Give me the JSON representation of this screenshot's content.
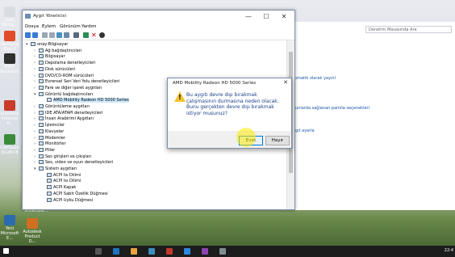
{
  "desktop": {
    "icons": [
      {
        "label": "Geri Dönüş...",
        "color": "#d9dde2"
      },
      {
        "label": "Samsung Kies 3",
        "color": "#e04c2a"
      },
      {
        "label": "ESET Sonkoruk...",
        "color": "#2f2f2f"
      },
      {
        "label": "Autodesk Inventor P...",
        "color": "#c83a2a"
      },
      {
        "label": "Camtasia Studio 8",
        "color": "#3a8a3a"
      },
      {
        "label": "Yeni Microsoft E...",
        "color": "#2b6cb0"
      },
      {
        "label": "Autodesk Product D...",
        "color": "#d07020"
      }
    ],
    "showcase_label": "Showcase..."
  },
  "device_manager": {
    "title": "Aygıt Yöneticisi",
    "window_controls": {
      "minimize": "—",
      "maximize": "☐",
      "close": "✕"
    },
    "menu": [
      "Dosya",
      "Eylem",
      "Görünüm",
      "Yardım"
    ],
    "tree": [
      {
        "label": "onay-Bilgisayar",
        "expander": "▾",
        "level": 0
      },
      {
        "label": "Ağ bağdaştırıcıları",
        "expander": "›",
        "level": 1
      },
      {
        "label": "Bilgisayar",
        "expander": "›",
        "level": 1
      },
      {
        "label": "Depolama denetleyicileri",
        "expander": "›",
        "level": 1
      },
      {
        "label": "Disk sürücüleri",
        "expander": "›",
        "level": 1
      },
      {
        "label": "DVD/CD-ROM sürücüleri",
        "expander": "›",
        "level": 1
      },
      {
        "label": "Evrensel Seri Veri Yolu denetleyicileri",
        "expander": "›",
        "level": 1
      },
      {
        "label": "Fare ve diğer işaret aygıtları",
        "expander": "›",
        "level": 1
      },
      {
        "label": "Görüntü bağdaştırıcıları",
        "expander": "▾",
        "level": 1
      },
      {
        "label": "AMD Mobility Radeon HD 5000 Series",
        "expander": "",
        "level": 2,
        "selected": true
      },
      {
        "label": "Görüntüleme aygıtları",
        "expander": "›",
        "level": 1
      },
      {
        "label": "IDE ATA/ATAPI denetleyicileri",
        "expander": "›",
        "level": 1
      },
      {
        "label": "İnsan Arabirimi Aygıtları",
        "expander": "›",
        "level": 1
      },
      {
        "label": "İşlemciler",
        "expander": "›",
        "level": 1
      },
      {
        "label": "Klavyeler",
        "expander": "›",
        "level": 1
      },
      {
        "label": "Modemler",
        "expander": "›",
        "level": 1
      },
      {
        "label": "Monitörler",
        "expander": "›",
        "level": 1
      },
      {
        "label": "Piller",
        "expander": "›",
        "level": 1
      },
      {
        "label": "Ses girişleri ve çıkışları",
        "expander": "›",
        "level": 1
      },
      {
        "label": "Ses, video ve oyun denetleyicileri",
        "expander": "›",
        "level": 1
      },
      {
        "label": "Sistem aygıtları",
        "expander": "▾",
        "level": 1
      },
      {
        "label": "ACPI Isı Dilimi",
        "expander": "",
        "level": 2
      },
      {
        "label": "ACPI Isı Dilimi",
        "expander": "",
        "level": 2
      },
      {
        "label": "ACPI Kapak",
        "expander": "",
        "level": 2
      },
      {
        "label": "ACPI Sabit Özellik Düğmesi",
        "expander": "",
        "level": 2
      },
      {
        "label": "ACPI Uyku Düğmesi",
        "expander": "",
        "level": 2
      }
    ]
  },
  "control_panel": {
    "search_placeholder": "Denetim Masasında Ara",
    "links": [
      "otomatik olarak yayınl",
      "oyunlarda sağlanan pamila seçenekleri",
      "aygıt ayarla"
    ]
  },
  "dialog": {
    "title": "AMD Mobility Radeon HD 5000 Series",
    "close": "✕",
    "message": "Bu aygıtı devre dışı bırakmak çalışmasının durmasına neden olacak. Bunu gerçekten devre dışı bırakmak istiyor musunuz?",
    "yes_label": "Evet",
    "no_label": "Hayır"
  },
  "taskbar": {
    "clock": "22:4"
  }
}
